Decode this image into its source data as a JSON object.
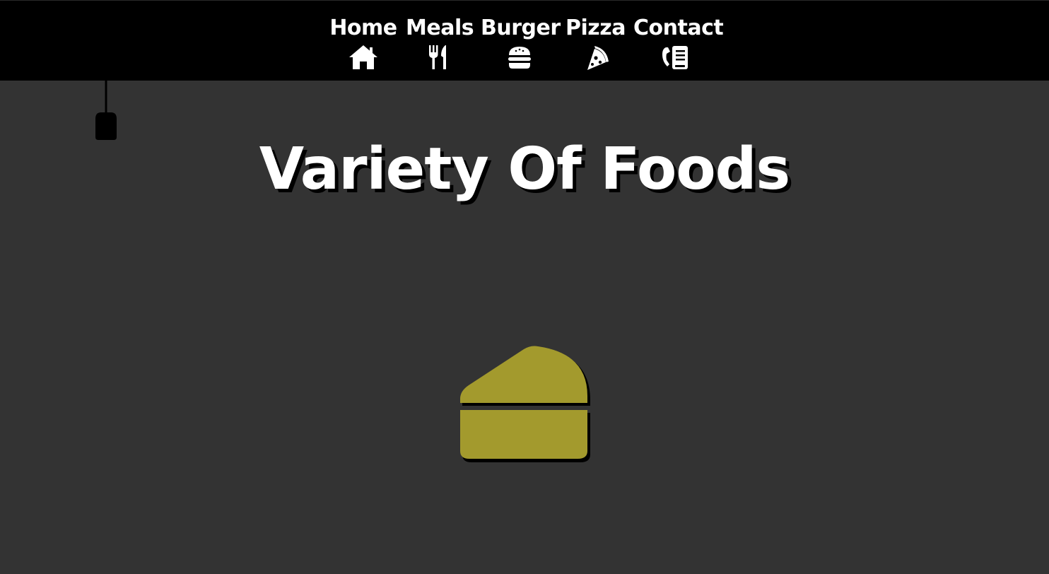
{
  "nav": {
    "items": [
      {
        "label": "Home",
        "icon": "home-icon"
      },
      {
        "label": "Meals",
        "icon": "fork-knife-icon"
      },
      {
        "label": "Burger",
        "icon": "burger-icon"
      },
      {
        "label": "Pizza",
        "icon": "pizza-slice-icon"
      },
      {
        "label": "Contact",
        "icon": "phone-book-icon"
      }
    ]
  },
  "hero": {
    "title": "Variety Of Foods"
  },
  "colors": {
    "background": "#333333",
    "navbar": "#000000",
    "text": "#ffffff",
    "cake": "#a39a2d"
  },
  "decor": {
    "lamp": "hanging-lamp-icon",
    "cake": "cake-slice-icon"
  }
}
